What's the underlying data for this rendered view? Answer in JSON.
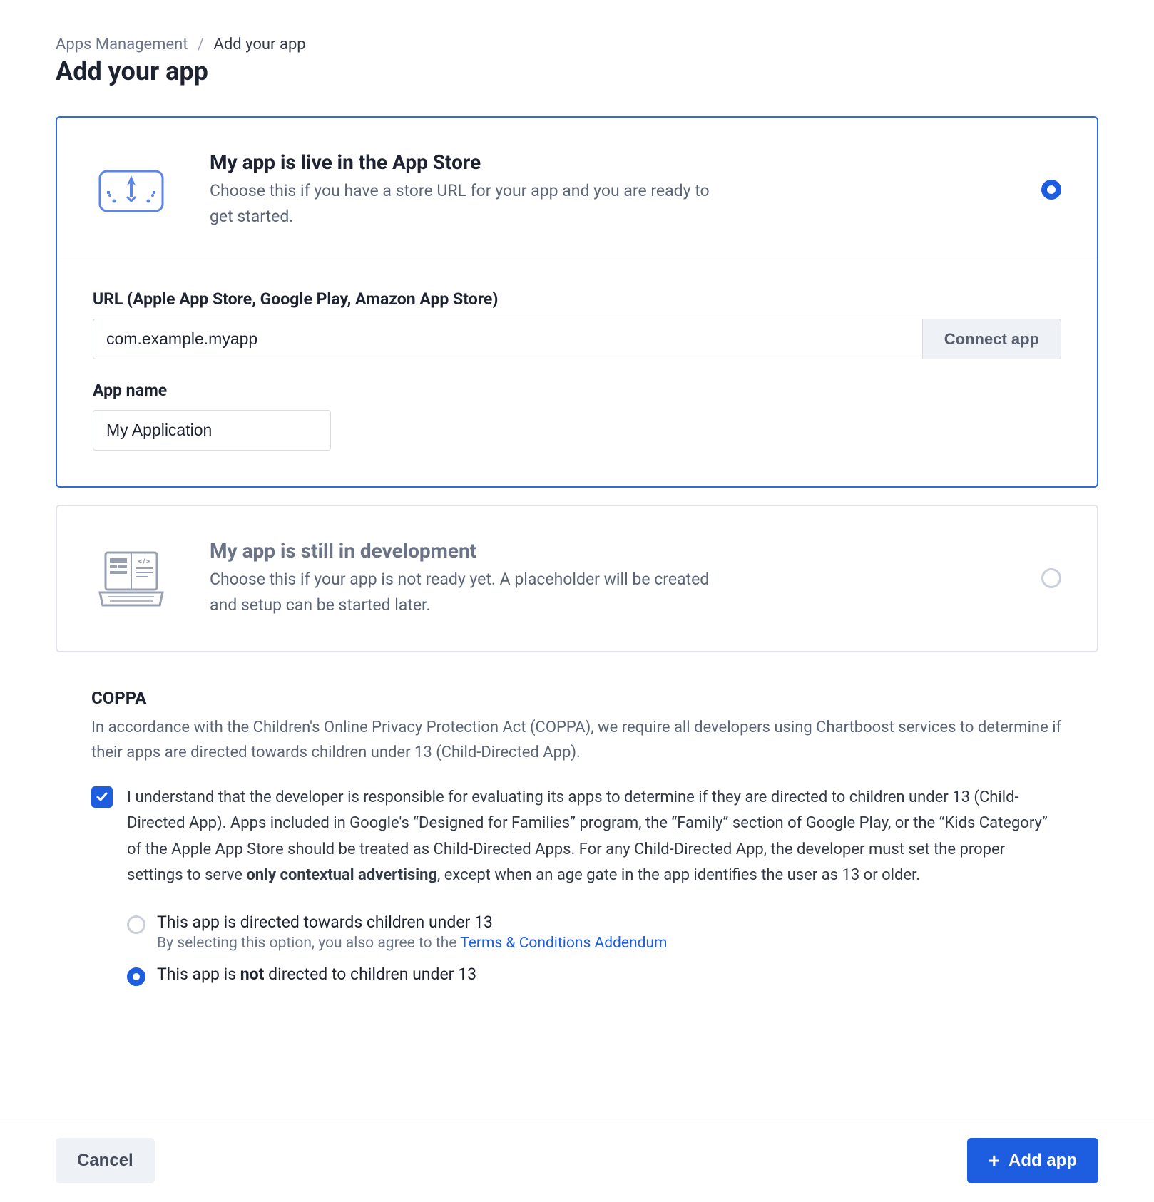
{
  "breadcrumb": {
    "root": "Apps Management",
    "separator": "/",
    "current": "Add your app"
  },
  "page_title": "Add your app",
  "option_live": {
    "title": "My app is live in the App Store",
    "description": "Choose this if you have a store URL for your app and you are ready to get started.",
    "selected": true,
    "url_field": {
      "label": "URL (Apple App Store, Google Play, Amazon App Store)",
      "value": "com.example.myapp",
      "connect_button": "Connect app"
    },
    "name_field": {
      "label": "App name",
      "value": "My Application"
    }
  },
  "option_dev": {
    "title": "My app is still in development",
    "description": "Choose this if your app is not ready yet. A placeholder will be created and setup can be started later.",
    "selected": false
  },
  "coppa": {
    "heading": "COPPA",
    "intro": "In accordance with the Children's Online Privacy Protection Act (COPPA), we require all developers using Chartboost services to determine if their apps are directed towards children under 13 (Child-Directed App).",
    "acknowledge_checked": true,
    "acknowledge_text_pre": "I understand that the developer is responsible for evaluating its apps to determine if they are directed to children under 13 (Child-Directed App). Apps included in Google's “Designed for Families” program, the “Family” section of Google Play, or the “Kids Category” of the Apple App Store should be treated as Child-Directed Apps. For any Child-Directed App, the developer must set the proper settings to serve ",
    "acknowledge_bold": "only contextual advertising",
    "acknowledge_text_post": ", except when an age gate in the app identifies the user as 13 or older.",
    "radio_directed": {
      "label": "This app is directed towards children under 13",
      "sub_pre": "By selecting this option, you also agree to the ",
      "sub_link": "Terms & Conditions Addendum",
      "checked": false
    },
    "radio_not_directed": {
      "label_pre": "This app is ",
      "label_bold": "not",
      "label_post": " directed to children under 13",
      "checked": true
    }
  },
  "footer": {
    "cancel": "Cancel",
    "add": "Add app"
  }
}
